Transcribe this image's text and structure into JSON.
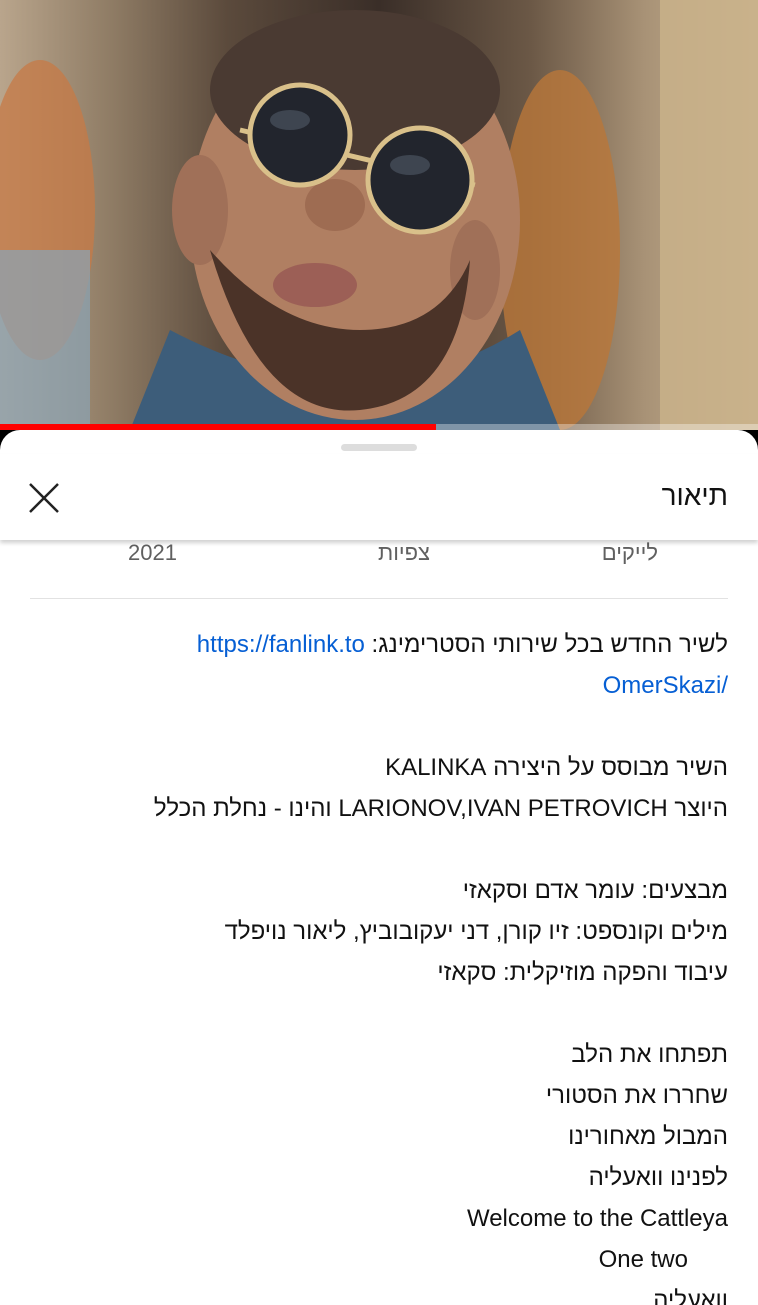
{
  "video": {
    "progress_fraction": 0.575,
    "progress_color": "#ff0000"
  },
  "panel": {
    "title": "תיאור",
    "close_icon": "close-icon"
  },
  "stats": {
    "likes_label": "לייקים",
    "views_label": "צפיות",
    "year": "2021"
  },
  "description": {
    "lead_text": "לשיר החדש בכל שירותי הסטרימינג: ",
    "link_part1": "https://fanlink.to",
    "link_part2": "/OmerSkazi",
    "based_on": "השיר מבוסס על היצירה KALINKA",
    "composer": "היוצר  LARIONOV,IVAN PETROVICH והינו - נחלת הכלל",
    "performers": "מבצעים: עומר אדם וסקאזי",
    "lyrics_concept": "מילים וקונספט: זיו קורן, דני יעקובוביץ, ליאור נויפלד",
    "production": "עיבוד והפקה מוזיקלית: סקאזי",
    "lyric1": "תפתחו את הלב",
    "lyric2": "שחררו את הסטורי",
    "lyric3": "המבול מאחורינו",
    "lyric4": "לפנינו וואעליה",
    "lyric5": "Welcome to the Cattleya",
    "lyric6": "One two",
    "lyric7": "וואעליה"
  }
}
